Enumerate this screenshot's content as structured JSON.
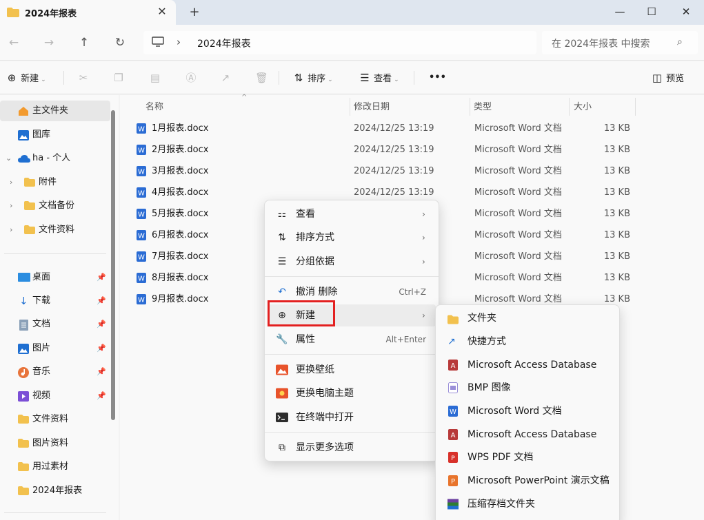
{
  "tab": {
    "title": "2024年报表",
    "close": "✕",
    "new_tab": "+"
  },
  "window_controls": {
    "minimize": "—",
    "maximize": "☐",
    "close": "✕"
  },
  "nav": {
    "back": "←",
    "forward": "→",
    "up": "↑",
    "refresh": "↻",
    "crumb": "2024年报表",
    "sep": "›"
  },
  "search": {
    "placeholder": "在 2024年报表 中搜索"
  },
  "toolbar": {
    "new_label": "新建",
    "sort_label": "排序",
    "view_label": "查看",
    "more_label": "•••",
    "preview_label": "预览"
  },
  "sidebar": {
    "items": [
      {
        "label": "主文件夹",
        "icon": "home-icon"
      },
      {
        "label": "图库",
        "icon": "gallery-icon"
      },
      {
        "label": "ha - 个人",
        "icon": "cloud-icon"
      },
      {
        "label": "附件",
        "icon": "folder-icon"
      },
      {
        "label": "文档备份",
        "icon": "folder-icon"
      },
      {
        "label": "文件资料",
        "icon": "folder-icon"
      },
      {
        "label": "桌面",
        "icon": "desktop-icon"
      },
      {
        "label": "下载",
        "icon": "download-icon"
      },
      {
        "label": "文档",
        "icon": "documents-icon"
      },
      {
        "label": "图片",
        "icon": "pictures-icon"
      },
      {
        "label": "音乐",
        "icon": "music-icon"
      },
      {
        "label": "视频",
        "icon": "video-icon"
      },
      {
        "label": "文件资料",
        "icon": "folder-icon"
      },
      {
        "label": "图片资料",
        "icon": "folder-icon"
      },
      {
        "label": "用过素材",
        "icon": "folder-icon"
      },
      {
        "label": "2024年报表",
        "icon": "folder-icon"
      }
    ]
  },
  "columns": {
    "name": "名称",
    "modified": "修改日期",
    "type": "类型",
    "size": "大小"
  },
  "files": [
    {
      "name": "1月报表.docx",
      "date": "2024/12/25 13:19",
      "type": "Microsoft Word 文档",
      "size": "13 KB"
    },
    {
      "name": "2月报表.docx",
      "date": "2024/12/25 13:19",
      "type": "Microsoft Word 文档",
      "size": "13 KB"
    },
    {
      "name": "3月报表.docx",
      "date": "2024/12/25 13:19",
      "type": "Microsoft Word 文档",
      "size": "13 KB"
    },
    {
      "name": "4月报表.docx",
      "date": "2024/12/25 13:19",
      "type": "Microsoft Word 文档",
      "size": "13 KB"
    },
    {
      "name": "5月报表.docx",
      "date": "",
      "type": "Microsoft Word 文档",
      "size": "13 KB"
    },
    {
      "name": "6月报表.docx",
      "date": "",
      "type": "Microsoft Word 文档",
      "size": "13 KB"
    },
    {
      "name": "7月报表.docx",
      "date": "",
      "type": "Microsoft Word 文档",
      "size": "13 KB"
    },
    {
      "name": "8月报表.docx",
      "date": "",
      "type": "Microsoft Word 文档",
      "size": "13 KB"
    },
    {
      "name": "9月报表.docx",
      "date": "",
      "type": "Microsoft Word 文档",
      "size": "13 KB"
    }
  ],
  "context_menu": {
    "view": "查看",
    "sort": "排序方式",
    "group": "分组依据",
    "undo": "撤消 删除",
    "undo_shortcut": "Ctrl+Z",
    "new": "新建",
    "properties": "属性",
    "properties_shortcut": "Alt+Enter",
    "wallpaper": "更换壁纸",
    "theme": "更换电脑主题",
    "terminal": "在终端中打开",
    "more": "显示更多选项"
  },
  "submenu": [
    "文件夹",
    "快捷方式",
    "Microsoft Access Database",
    "BMP 图像",
    "Microsoft Word 文档",
    "Microsoft Access Database",
    "WPS PDF 文档",
    "Microsoft PowerPoint 演示文稿",
    "压缩存档文件夹"
  ],
  "colors": {
    "accent": "#1f6fd1",
    "folder": "#f2c14e",
    "highlight": "#e32020"
  }
}
